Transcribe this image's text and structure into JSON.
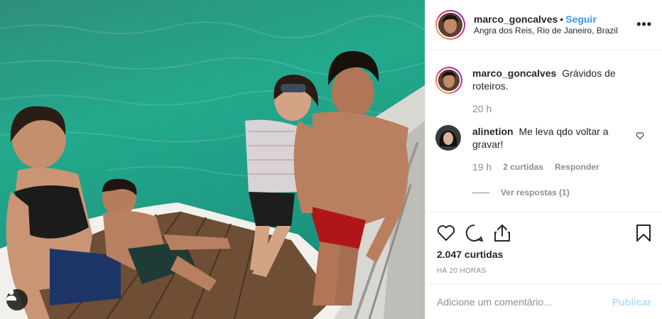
{
  "post": {
    "username": "marco_goncalves",
    "follow_label": "Seguir",
    "separator": "•",
    "location": "Angra dos Reis, Rio de Janeiro, Brazil",
    "more_label": "•••"
  },
  "caption": {
    "username": "marco_goncalves",
    "text": "Grávidos de roteiros.",
    "time": "20 h"
  },
  "comments": [
    {
      "username": "alinetion",
      "text": "Me leva qdo voltar a gravar!",
      "time": "19 h",
      "likes": "2 curtidas",
      "reply_label": "Responder",
      "view_replies": "Ver respostas (1)"
    }
  ],
  "stats": {
    "likes": "2.047 curtidas",
    "age": "HÁ 20 HORAS"
  },
  "add_comment": {
    "placeholder": "Adicione um comentário...",
    "publish_label": "Publicar"
  },
  "icons": {
    "like": "heart-icon",
    "comment": "comment-icon",
    "share": "share-icon",
    "save": "bookmark-icon",
    "tag": "user-tag-icon"
  },
  "colors": {
    "accent": "#3897f0",
    "publish_disabled": "#b2dffc",
    "water": "#1f9d84"
  }
}
